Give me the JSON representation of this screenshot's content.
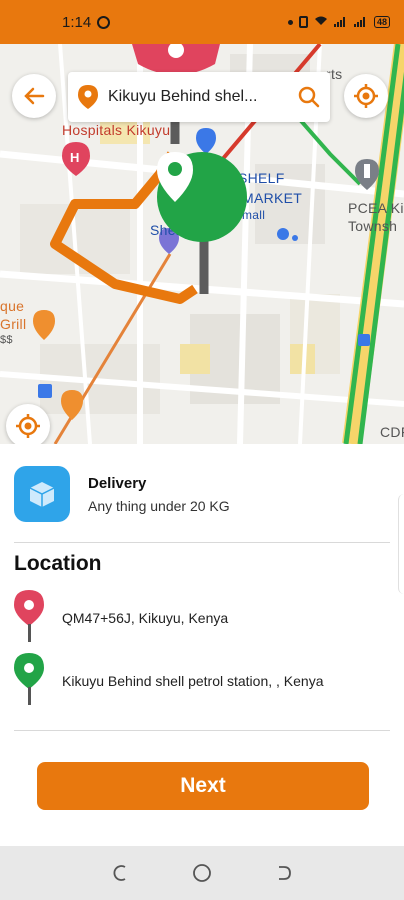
{
  "status_bar": {
    "time": "1:14",
    "battery": "48"
  },
  "map": {
    "search_text": "Kikuyu Behind shel...",
    "labels": {
      "hospitals": "Hospitals Kikuyu",
      "shelf_market_1": "SHELF",
      "shelf_market_2": "MARKET",
      "mall": "mall",
      "shell": "Shell",
      "pcea_1": "PCEA Ki",
      "pcea_2": "Townsh",
      "grill_1": "que",
      "grill_2": "Grill",
      "grill_3": "$$",
      "arts": "rts",
      "cdf": "CDF"
    }
  },
  "delivery": {
    "title": "Delivery",
    "subtitle": "Any thing under 20 KG"
  },
  "location": {
    "title": "Location",
    "pickup": "QM47+56J, Kikuyu, Kenya",
    "dropoff": "Kikuyu Behind shell petrol station, , Kenya"
  },
  "next_label": "Next",
  "colors": {
    "accent": "#E8780E",
    "pickup": "#E0445E",
    "dropoff": "#22A447",
    "delivery_icon_bg": "#2fa4e9"
  }
}
